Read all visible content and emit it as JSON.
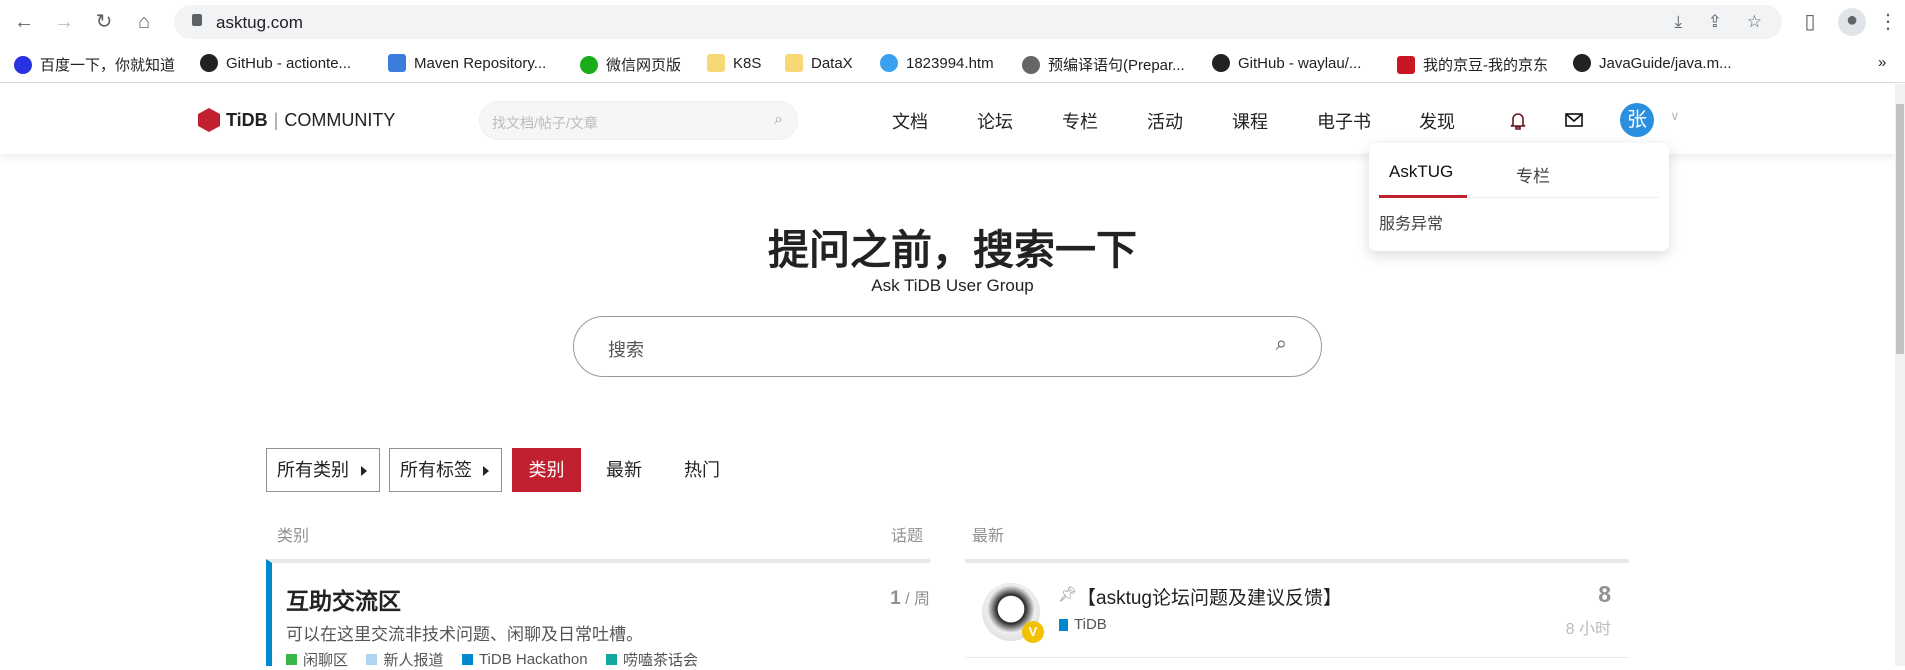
{
  "browser": {
    "url": "asktug.com",
    "bookmarks": [
      "百度一下，你就知道",
      "GitHub - actionte...",
      "Maven Repository...",
      "微信网页版",
      "K8S",
      "DataX",
      "1823994.htm",
      "预编译语句(Prepar...",
      "GitHub - waylau/...",
      "我的京豆-我的京东",
      "JavaGuide/java.m..."
    ],
    "more": "»"
  },
  "header": {
    "logo_brand": "TiDB",
    "logo_text": "COMMUNITY",
    "search_placeholder": "找文档/帖子/文章",
    "nav": [
      "文档",
      "论坛",
      "专栏",
      "活动",
      "课程",
      "电子书",
      "发现"
    ],
    "avatar_letter": "张"
  },
  "dropdown": {
    "tabs": [
      "AskTUG",
      "专栏"
    ],
    "item": "服务异常"
  },
  "hero": {
    "title": "提问之前，搜索一下",
    "subtitle": "Ask TiDB User Group",
    "search_placeholder": "搜索"
  },
  "filters": {
    "all_categories": "所有类别",
    "all_tags": "所有标签",
    "tabs": [
      "类别",
      "最新",
      "热门"
    ]
  },
  "categories": {
    "header": "类别",
    "topics_header": "话题",
    "items": [
      {
        "name": "互助交流区",
        "count": "1",
        "period": "/ 周",
        "description": "可以在这里交流非技术问题、闲聊及日常吐槽。",
        "color": "#0088cc",
        "subcategories": [
          {
            "name": "闲聊区",
            "color": "#3ab54a"
          },
          {
            "name": "新人报道",
            "color": "#aed6f1"
          },
          {
            "name": "TiDB Hackathon",
            "color": "#0088cc"
          },
          {
            "name": "唠嗑茶话会",
            "color": "#12a89d"
          }
        ]
      }
    ]
  },
  "latest": {
    "header": "最新",
    "topics": [
      {
        "title": "【asktug论坛问题及建议反馈】",
        "category": "TiDB",
        "category_color": "#0088cc",
        "replies": "8",
        "age": "8 小时",
        "badge": "V"
      }
    ]
  }
}
